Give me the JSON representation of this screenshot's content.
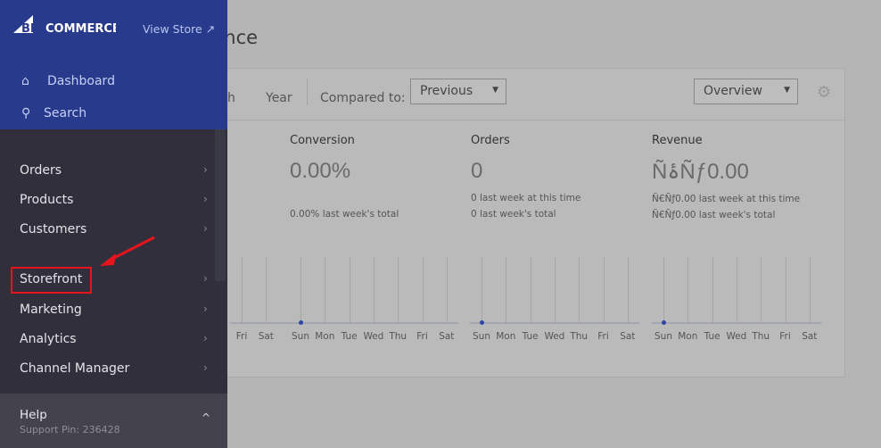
{
  "page": {
    "title": "Performance"
  },
  "toolbar": {
    "month": "Month",
    "year": "Year",
    "compared_label": "Compared to:",
    "compared_value": "Previous",
    "view_value": "Overview"
  },
  "metrics": [
    {
      "title": "Conversion",
      "value": "0.00%",
      "sub1": "",
      "sub2": "0.00% last week's total"
    },
    {
      "title": "Orders",
      "value": "0",
      "sub1": "0 last week at this time",
      "sub2": "0 last week's total"
    },
    {
      "title": "Revenue",
      "value": "ÑۀÑƒ0.00",
      "sub1": "Ñ€Ñƒ0.00 last week at this time",
      "sub2": "Ñ€Ñƒ0.00 last week's total"
    }
  ],
  "days": [
    "Sun",
    "Mon",
    "Tue",
    "Wed",
    "Thu",
    "Fri",
    "Sat"
  ],
  "sidebar": {
    "brand": "BIGCOMMERCE",
    "view_store": "View Store",
    "dashboard": "Dashboard",
    "search": "Search",
    "items": [
      "Orders",
      "Products",
      "Customers",
      "Storefront",
      "Marketing",
      "Analytics",
      "Channel Manager"
    ],
    "help": "Help",
    "support_pin": "Support Pin: 236428"
  },
  "colors": {
    "sidebar_top": "#283a8c",
    "sidebar": "#302f3b",
    "annotation": "#e8141c"
  }
}
